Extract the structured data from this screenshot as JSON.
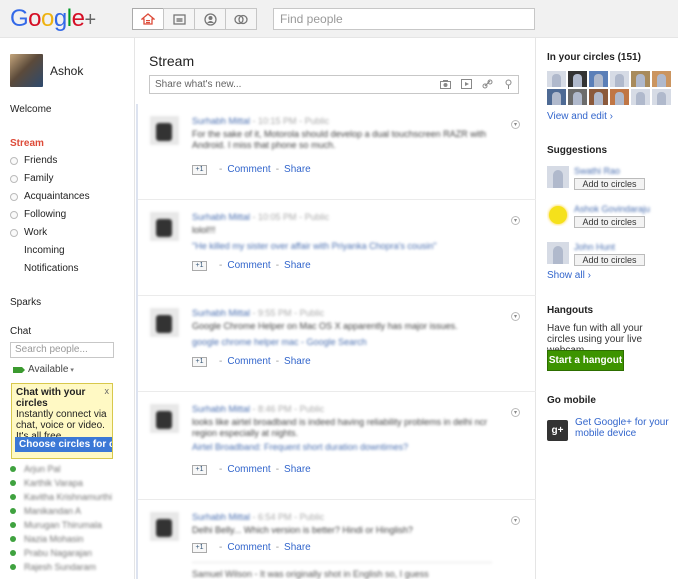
{
  "colors": {
    "accent_red": "#dd4b39",
    "link_blue": "#3366cc",
    "hangout_green": "#3d9400",
    "promo_yellow": "#fff9c4"
  },
  "logo": {
    "parts": [
      "G",
      "o",
      "o",
      "g",
      "l",
      "e",
      "+"
    ]
  },
  "topbar": {
    "nav_icons": [
      "home-icon",
      "photos-icon",
      "profile-icon",
      "circles-icon"
    ],
    "search_placeholder": "Find people"
  },
  "left": {
    "profile_name": "Ashok",
    "welcome": "Welcome",
    "stream": "Stream",
    "circles": [
      "Friends",
      "Family",
      "Acquaintances",
      "Following",
      "Work"
    ],
    "incoming": "Incoming",
    "notifications": "Notifications",
    "sparks": "Sparks",
    "chat": "Chat",
    "chat_search_placeholder": "Search people...",
    "available": "Available",
    "promo": {
      "title": "Chat with your circles",
      "body": "Instantly connect via chat, voice or video. It's all free.",
      "close": "x",
      "button": "Choose circles for c"
    },
    "contacts": [
      "Arjun Pal",
      "Karthik Varapa",
      "Kavitha Krishnamurthi",
      "Manikandan A",
      "Murugan Thirumala",
      "Nazia Mohasin",
      "Prabu Nagarajan",
      "Rajesh Sundaram"
    ]
  },
  "main": {
    "title": "Stream",
    "share_placeholder": "Share what's new...",
    "share_icons": [
      "camera-icon",
      "video-icon",
      "link-icon",
      "location-icon"
    ],
    "plus_one": "+1",
    "comment": "Comment",
    "share": "Share",
    "dash": "-",
    "posts": [
      {
        "author": "Surhabh Mittal",
        "time": "10:15 PM",
        "visibility": "Public",
        "text": "For the sake of it, Motorola should develop a dual touchscreen RAZR with Android. I miss that phone so much.",
        "link": ""
      },
      {
        "author": "Surhabh Mittal",
        "time": "10:05 PM",
        "visibility": "Public",
        "text": "lolol!!!",
        "link": "\"He killed my sister over affair with Priyanka Chopra's cousin\""
      },
      {
        "author": "Surhabh Mittal",
        "time": "9:55 PM",
        "visibility": "Public",
        "text": "Google Chrome Helper on Mac OS X apparently has major issues.",
        "link": "google chrome helper mac - Google Search"
      },
      {
        "author": "Surhabh Mittal",
        "time": "8:46 PM",
        "visibility": "Public",
        "text": "looks like airtel broadband is indeed having reliability problems in delhi ncr region especially at nights.",
        "link": "Airtel Broadband: Frequent short duration downtimes?"
      },
      {
        "author": "Surhabh Mittal",
        "time": "6:54 PM",
        "visibility": "Public",
        "text": "Delhi Belly... Which version is better? Hindi or Hinglish?",
        "link": ""
      }
    ],
    "comment_preview": "Samuel Wilson - It was originally shot in English so, I guess"
  },
  "right": {
    "in_circles": "In your circles (151)",
    "view_edit": "View and edit ›",
    "suggestions_title": "Suggestions",
    "suggestions": [
      {
        "name": "Swathi Rao",
        "button": "Add to circles"
      },
      {
        "name": "Ashok Govindaraju",
        "button": "Add to circles"
      },
      {
        "name": "John Hunt",
        "button": "Add to circles"
      }
    ],
    "show_all": "Show all ›",
    "hangouts_title": "Hangouts",
    "hangouts_desc": "Have fun with all your circles using your live webcam.",
    "hangout_button": "Start a hangout",
    "go_mobile_title": "Go mobile",
    "gplus_icon": "g+",
    "mobile_link": "Get Google+ for your mobile device"
  }
}
